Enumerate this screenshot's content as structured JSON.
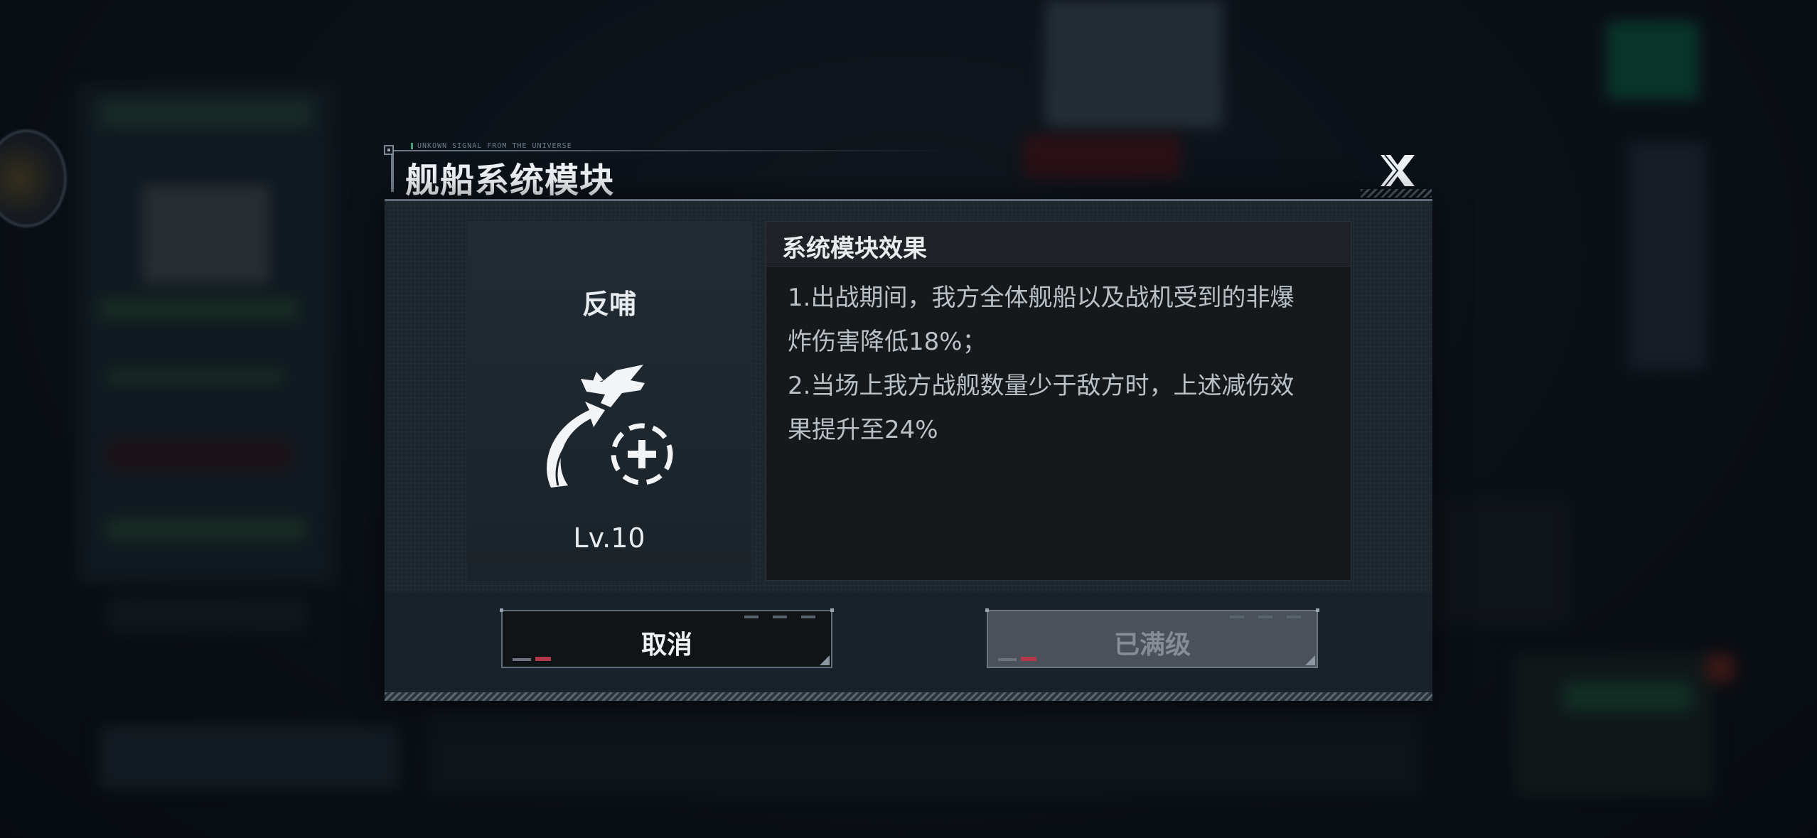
{
  "dialog": {
    "signal_text": "UNKOWN SIGNAL FROM THE UNIVERSE",
    "title": "舰船系统模块",
    "close_icon": "close-x-icon"
  },
  "module": {
    "name": "反哺",
    "icon": "fighter-reinforce-icon",
    "level": "Lv.10"
  },
  "effect": {
    "title": "系统模块效果",
    "lines": [
      "1.出战期间，我方全体舰船以及战机受到的非爆炸伤害降低18%；",
      "2.当场上我方战舰数量少于敌方时，上述减伤效果提升至24%"
    ]
  },
  "buttons": {
    "cancel_label": "取消",
    "max_label": "已满级"
  },
  "colors": {
    "dialog_bg": "#1d252d",
    "effect_bg": "#16191c",
    "cancel_bg": "#111417",
    "max_bg": "#4a5158",
    "accent_red": "#b3364a",
    "accent_green": "#3fa27a"
  }
}
